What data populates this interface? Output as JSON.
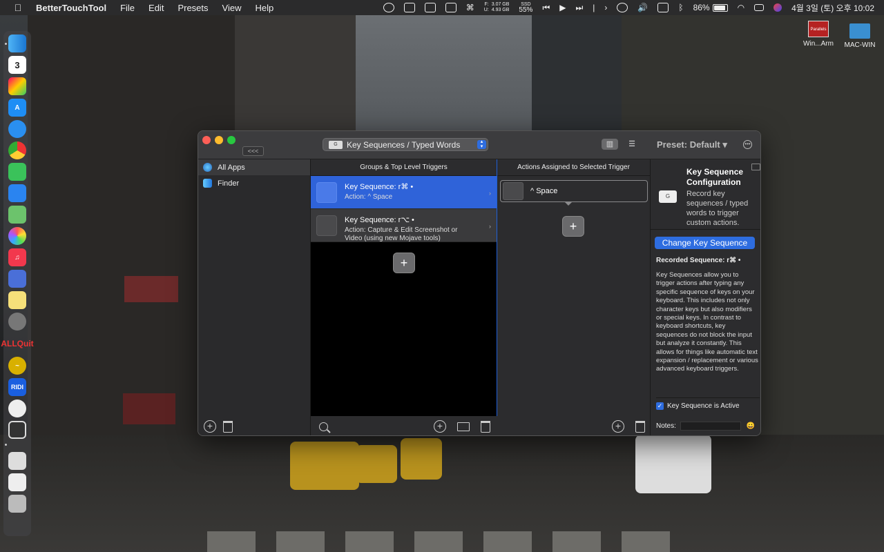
{
  "menubar": {
    "app_name": "BetterTouchTool",
    "menus": [
      "File",
      "Edit",
      "Presets",
      "View",
      "Help"
    ],
    "mem_top": "3.07 GB",
    "mem_bottom": "4.93 GB",
    "mem_labels": [
      "F:",
      "U:"
    ],
    "ssd_label": "SSD",
    "ssd_value": "55%",
    "battery": "86%",
    "datetime": "4월 3일 (토) 오후 10:02"
  },
  "desktop": {
    "icons": [
      {
        "label": "Win...Arm",
        "badge": "Parallels"
      },
      {
        "label": "MAC-WIN"
      }
    ]
  },
  "dock": {
    "calendar_day": "3",
    "allquit": [
      "ALL",
      "Quit"
    ],
    "ridi": "RIDI"
  },
  "window": {
    "collapse_label": "<<<",
    "trigger_select": "Key Sequences / Typed Words",
    "trigger_icon_text": "G",
    "preset_label": "Preset: Default ▾",
    "apps": [
      {
        "name": "All Apps",
        "selected": true
      },
      {
        "name": "Finder",
        "selected": false
      }
    ],
    "groups_header": "Groups & Top Level Triggers",
    "actions_header": "Actions Assigned to Selected Trigger",
    "triggers": [
      {
        "title": "Key Sequence: r⌘ •",
        "action": "Action: ^ Space",
        "selected": true
      },
      {
        "title": "Key Sequence: r⌥ •",
        "action": "Action: Capture & Edit Screenshot or Video (using new Mojave tools)",
        "selected": false
      }
    ],
    "assigned_action": "^ Space",
    "config": {
      "title": "Key Sequence Configuration",
      "subtitle": "Record key sequences / typed words to trigger custom actions.",
      "change_button": "Change Key Sequence",
      "recorded": "Recorded Sequence: r⌘ •",
      "description": "Key Sequences allow you to trigger actions after typing any specific sequence of keys on your keyboard. This includes not only character keys but also modifiers or special keys. In contrast to keyboard shortcuts, key sequences do not block the input but analyze it constantly. This allows for things like automatic text expansion / replacement or various advanced keyboard triggers.",
      "active_label": "Key Sequence is Active",
      "notes_label": "Notes:"
    }
  },
  "colors": {
    "accent": "#2e6de0",
    "selected_row": "#2f63d9"
  }
}
